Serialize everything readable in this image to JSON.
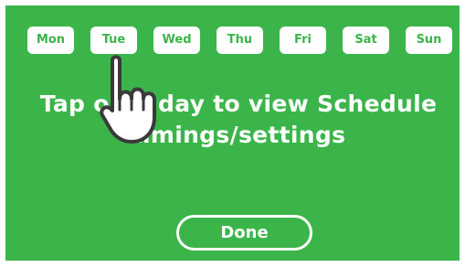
{
  "days": [
    "Mon",
    "Tue",
    "Wed",
    "Thu",
    "Fri",
    "Sat",
    "Sun"
  ],
  "message": {
    "line1": "Tap on a day to view Schedule",
    "line2": "timings/settings"
  },
  "done_label": "Done",
  "colors": {
    "panel": "#3bb54a",
    "button_text": "#3bb54a",
    "text": "#ffffff"
  },
  "icons": {
    "pointer": "tap-hand-icon"
  }
}
